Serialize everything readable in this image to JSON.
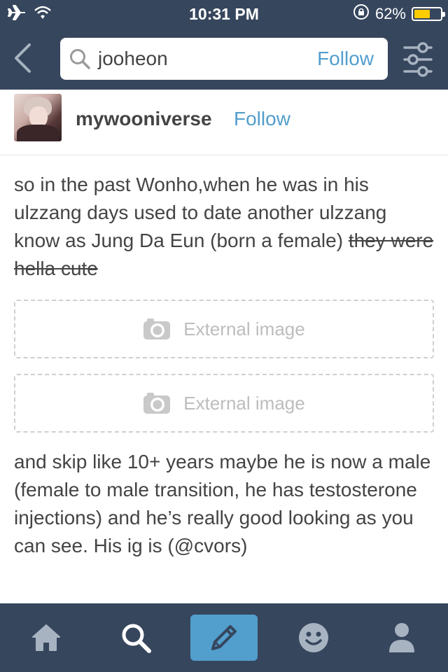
{
  "status_bar": {
    "time": "10:31 PM",
    "battery_text": "62%",
    "battery_level": 0.62,
    "icons": [
      "airplane-icon",
      "wifi-icon",
      "rotation-lock-icon",
      "battery-icon"
    ]
  },
  "header": {
    "search_query": "jooheon",
    "follow_label": "Follow",
    "icons": [
      "back-chevron-icon",
      "search-icon",
      "filter-sliders-icon"
    ]
  },
  "post": {
    "blog_name": "mywooniverse",
    "follow_label": "Follow",
    "text_1": "so in the past Wonho,when he was in his ulzzang days used to date another ulzzang know as Jung Da Eun (born a female) ",
    "text_1_strike": "they were hella cute",
    "images": [
      {
        "label": "External image",
        "icon": "camera-icon"
      },
      {
        "label": "External image",
        "icon": "camera-icon"
      }
    ],
    "text_2": "and skip like 10+ years maybe he is now a male (female to male transition, he has testosterone injections) and he’s really good looking as you can see. His ig is (@cvors)"
  },
  "tabbar": {
    "items": [
      {
        "name": "home",
        "icon": "home-icon",
        "active": false
      },
      {
        "name": "search",
        "icon": "search-icon",
        "active": false
      },
      {
        "name": "compose",
        "icon": "pencil-icon",
        "active": true
      },
      {
        "name": "activity",
        "icon": "smiley-icon",
        "active": false
      },
      {
        "name": "account",
        "icon": "person-icon",
        "active": false
      }
    ]
  },
  "colors": {
    "navy": "#36465d",
    "accent_blue": "#529ecc",
    "text": "#444444",
    "battery": "#ffcc00"
  }
}
